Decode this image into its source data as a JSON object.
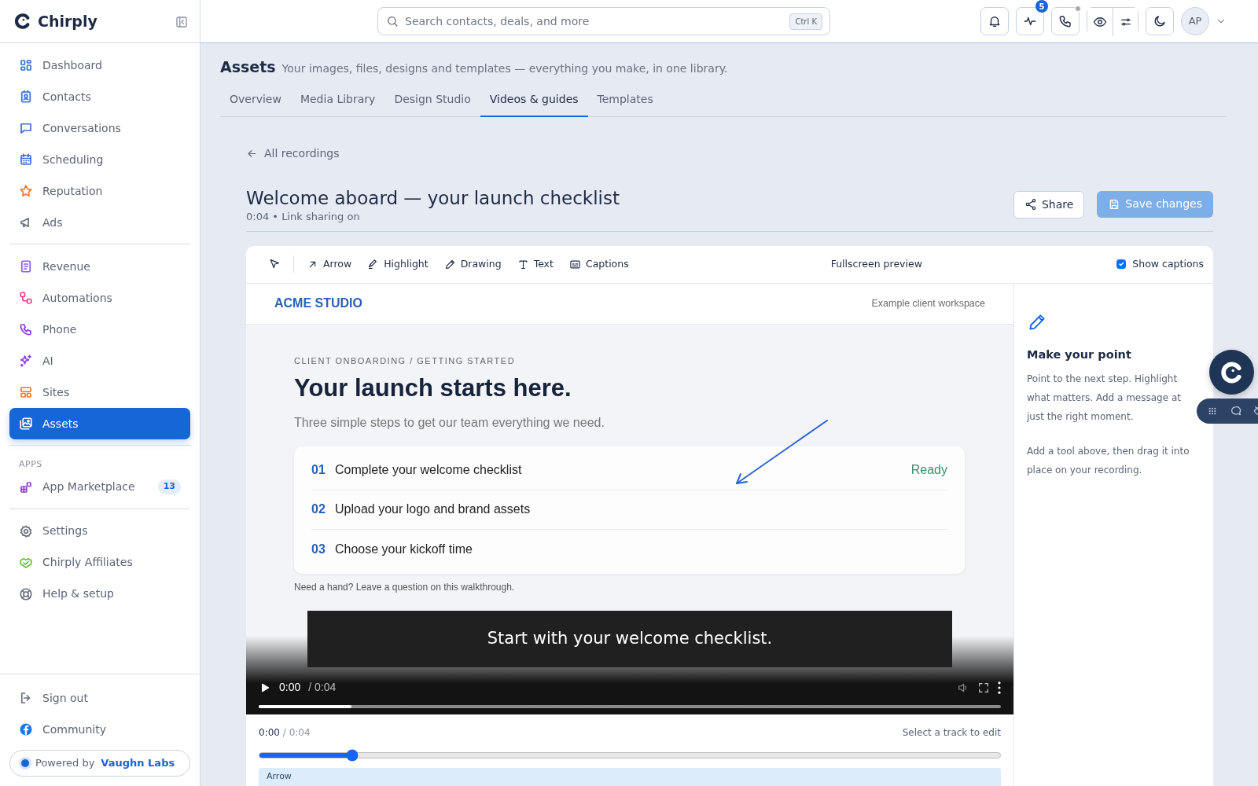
{
  "app": {
    "brand": "Chirply"
  },
  "sidebar": {
    "groups": [
      {
        "items": [
          {
            "label": "Dashboard",
            "color": "#3b6fd8",
            "selected": false
          },
          {
            "label": "Contacts",
            "color": "#3b6fd8",
            "selected": false
          },
          {
            "label": "Conversations",
            "color": "#3b6fd8",
            "selected": false
          },
          {
            "label": "Scheduling",
            "color": "#3b6fd8",
            "selected": false
          },
          {
            "label": "Reputation",
            "color": "#f0782d",
            "selected": false
          },
          {
            "label": "Ads",
            "color": "#6b7280",
            "selected": false
          }
        ]
      },
      {
        "items": [
          {
            "label": "Revenue",
            "color": "#8b5cf6",
            "selected": false
          },
          {
            "label": "Automations",
            "color": "#e83e8c",
            "selected": false
          },
          {
            "label": "Phone",
            "color": "#8b3fd9",
            "selected": false
          },
          {
            "label": "AI",
            "color": "#8b3fd9",
            "selected": false
          },
          {
            "label": "Sites",
            "color": "#f0782d",
            "selected": false
          },
          {
            "label": "Assets",
            "color": "#ffffff",
            "selected": true
          }
        ]
      },
      {
        "heading": "APPS",
        "items": [
          {
            "label": "App Marketplace",
            "color": "#8b3fd9",
            "badge": "13",
            "selected": false
          }
        ]
      },
      {
        "items": [
          {
            "label": "Settings",
            "color": "#6b7280",
            "selected": false
          },
          {
            "label": "Chirply Affiliates",
            "color": "#65c23a",
            "selected": false
          },
          {
            "label": "Help & setup",
            "color": "#6b7280",
            "selected": false
          }
        ]
      }
    ],
    "footer": [
      {
        "label": "Sign out",
        "color": "#6b7280"
      },
      {
        "label": "Community",
        "color": "#1877f2"
      }
    ],
    "powered": {
      "prefix": "Powered by",
      "name": "Vaughn Labs"
    }
  },
  "topbar": {
    "search": {
      "placeholder": "Search contacts, deals, and more",
      "shortcut": "Ctrl K"
    },
    "activity_badge": "5",
    "avatar": "AP"
  },
  "page": {
    "title": "Assets",
    "subtitle": "Your images, files, designs and templates — everything you make, in one library.",
    "tabs": [
      {
        "label": "Overview",
        "selected": false
      },
      {
        "label": "Media Library",
        "selected": false
      },
      {
        "label": "Design Studio",
        "selected": false
      },
      {
        "label": "Videos & guides",
        "selected": true
      },
      {
        "label": "Templates",
        "selected": false
      }
    ]
  },
  "recording": {
    "back": "All recordings",
    "title": "Welcome aboard — your launch checklist",
    "meta": "0:04 • Link sharing on",
    "share": "Share",
    "save": {
      "label": "Save changes",
      "disabled": true
    }
  },
  "editor": {
    "tools": [
      {
        "label": "Arrow"
      },
      {
        "label": "Highlight"
      },
      {
        "label": "Drawing"
      },
      {
        "label": "Text"
      },
      {
        "label": "Captions"
      }
    ],
    "preview": "Fullscreen preview",
    "show_captions": {
      "label": "Show captions",
      "checked": true
    }
  },
  "video": {
    "brand": "ACME STUDIO",
    "workspace": "Example client workspace",
    "eyebrow": "CLIENT ONBOARDING / GETTING STARTED",
    "heading": "Your launch starts here.",
    "lead": "Three simple steps to get our team everything we need.",
    "steps": [
      {
        "number": "01",
        "label": "Complete your welcome checklist",
        "status": "Ready"
      },
      {
        "number": "02",
        "label": "Upload your logo and brand assets"
      },
      {
        "number": "03",
        "label": "Choose your kickoff time"
      }
    ],
    "help": "Need a hand? Leave a question on this walkthrough.",
    "caption": "Start with your welcome checklist.",
    "player": {
      "current": "0:00",
      "duration": "/ 0:04",
      "level": 0.125
    }
  },
  "timeline": {
    "current": "0:00",
    "duration": "/ 0:04",
    "hint": "Select a track to edit",
    "level": 0.125,
    "tracks": [
      {
        "label": "Arrow"
      }
    ]
  },
  "panel": {
    "title": "Make your point",
    "paragraphs": [
      "Point to the next step. Highlight what matters. Add a message at just the right moment.",
      "Add a tool above, then drag it into place on your recording."
    ]
  }
}
